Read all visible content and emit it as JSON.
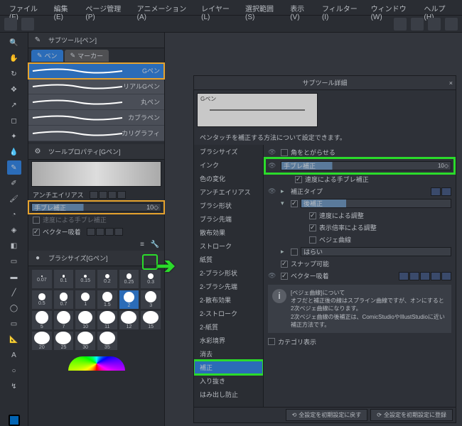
{
  "menubar": [
    "ファイル(F)",
    "編集(E)",
    "ページ管理(P)",
    "アニメーション(A)",
    "レイヤー(L)",
    "選択範囲(S)",
    "表示(V)",
    "フィルター(I)",
    "ウィンドウ(W)",
    "ヘルプ(H)"
  ],
  "subtool": {
    "title": "サブツール[ペン]",
    "tabs": [
      {
        "label": "ペン",
        "active": true
      },
      {
        "label": "マーカー",
        "active": false
      }
    ],
    "items": [
      {
        "label": "Gペン",
        "sel": true,
        "hl": "orange"
      },
      {
        "label": "リアルGペン"
      },
      {
        "label": "丸ペン"
      },
      {
        "label": "カブラペン"
      },
      {
        "label": "カリグラフィ"
      }
    ]
  },
  "toolprop": {
    "title": "ツールプロパティ[Gペン]",
    "antialias": "アンチエイリアス",
    "stabilize": {
      "label": "手ブレ補正",
      "value": "10"
    },
    "speed_adj": "速度による手ブレ補正",
    "vector_snap": "ベクター吸着"
  },
  "brushsize": {
    "title": "ブラシサイズ[Gペン]",
    "labels": [
      "0.07",
      "0.1",
      "0.15",
      "0.2",
      "0.25",
      "0.3",
      "0.5",
      "0.7",
      "1",
      "1.5",
      "2",
      "3",
      "5",
      "7",
      "10",
      "11",
      "12",
      "15",
      "20",
      "25",
      "30",
      "35"
    ]
  },
  "detail": {
    "title": "サブツール詳細",
    "preview_label": "Gペン",
    "desc": "ペンタッチを補正する方法について設定できます。",
    "categories": [
      "ブラシサイズ",
      "インク",
      "色の変化",
      "アンチエイリアス",
      "ブラシ形状",
      "ブラシ先端",
      "散布効果",
      "ストローク",
      "紙質",
      "2-ブラシ形状",
      "2-ブラシ先端",
      "2-散布効果",
      "2-ストローク",
      "2-紙質",
      "水彩境界",
      "消去",
      "補正",
      "入り抜き",
      "はみ出し防止"
    ],
    "sel_cat": "補正",
    "rows": {
      "corner": "角をとがらせる",
      "stabilize": {
        "label": "手ブレ補正",
        "value": "10"
      },
      "speed": "速度による手ブレ補正",
      "corr_type": "補正タイプ",
      "post": "後補正",
      "speed_adj": "速度による調整",
      "zoom_adj": "表示倍率による調整",
      "bezier": "ベジェ曲線",
      "taper": "はらい",
      "snap": "スナップ可能",
      "vsnap": "ベクター吸着"
    },
    "info_title": "[ベジェ曲線]について",
    "info_body": "オフだと補正後の線はスプライン曲線ですが、オンにすると2次ベジェ曲線になります。\n2次ベジェ曲線の後補正は、ComicStudioやIllustStudioに近い補正方法です。",
    "cat_show": "カテゴリ表示",
    "footer": {
      "reset": "全設定を初期設定に戻す",
      "save": "全設定を初期設定に登録"
    }
  }
}
